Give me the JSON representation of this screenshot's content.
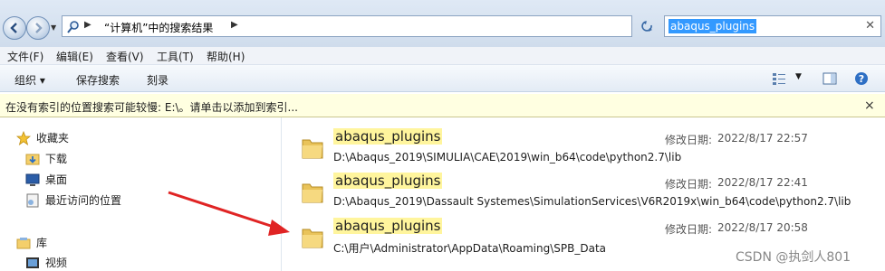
{
  "address": {
    "crumb": "“计算机”中的搜索结果",
    "search_value": "abaqus_plugins"
  },
  "menu": {
    "file": "文件(F)",
    "edit": "编辑(E)",
    "view": "查看(V)",
    "tools": "工具(T)",
    "help": "帮助(H)"
  },
  "toolbar": {
    "organize": "组织 ▾",
    "save_search": "保存搜索",
    "burn": "刻录"
  },
  "infobar": {
    "message": "在没有索引的位置搜索可能较慢: E:\\。请单击以添加到索引...",
    "close": "×"
  },
  "nav": {
    "favorites": "收藏夹",
    "downloads": "下载",
    "desktop": "桌面",
    "recent": "最近访问的位置",
    "libraries": "库",
    "videos": "视频"
  },
  "results": [
    {
      "name": "abaqus_plugins",
      "date_label": "修改日期:",
      "date": "2022/8/17 22:57",
      "path": "D:\\Abaqus_2019\\SIMULIA\\CAE\\2019\\win_b64\\code\\python2.7\\lib"
    },
    {
      "name": "abaqus_plugins",
      "date_label": "修改日期:",
      "date": "2022/8/17 22:41",
      "path": "D:\\Abaqus_2019\\Dassault Systemes\\SimulationServices\\V6R2019x\\win_b64\\code\\python2.7\\lib"
    },
    {
      "name": "abaqus_plugins",
      "date_label": "修改日期:",
      "date": "2022/8/17 20:58",
      "path": "C:\\用户\\Administrator\\AppData\\Roaming\\SPB_Data"
    }
  ],
  "watermark": "CSDN @执剑人801",
  "colors": {
    "highlight": "#fff59d",
    "infobar": "#ffffe1",
    "selection": "#3399ff",
    "arrow": "#e02424"
  }
}
